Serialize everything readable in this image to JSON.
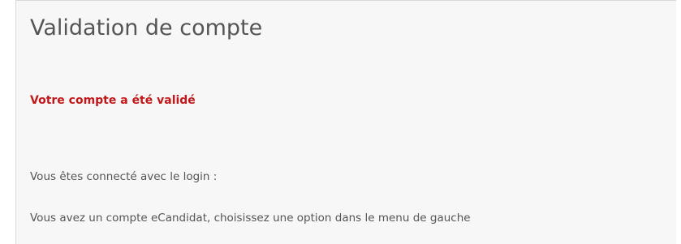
{
  "page": {
    "title": "Validation de compte"
  },
  "message": {
    "status": "Votre compte a été validé",
    "login_line": "Vous êtes connecté avec le login :",
    "menu_line": "Vous avez un compte eCandidat, choisissez une option dans le menu de gauche"
  },
  "colors": {
    "status_text": "#c0191a",
    "body_text": "#555555",
    "panel_background": "#f7f7f7"
  }
}
